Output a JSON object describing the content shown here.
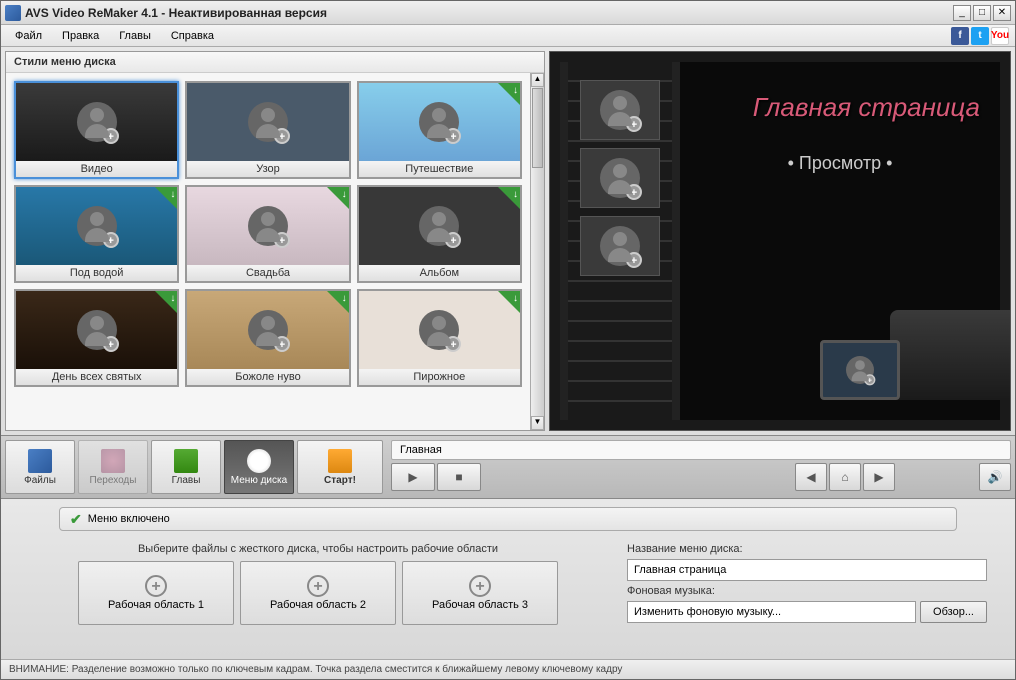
{
  "window": {
    "title": "AVS Video ReMaker 4.1 - Неактивированная версия"
  },
  "menubar": [
    "Файл",
    "Правка",
    "Главы",
    "Справка"
  ],
  "social": {
    "fb": "f",
    "tw": "t",
    "yt": "You"
  },
  "styles_panel": {
    "header": "Стили меню диска",
    "items": [
      {
        "label": "Видео",
        "thumb": "video",
        "selected": true,
        "download": false
      },
      {
        "label": "Узор",
        "thumb": "pattern",
        "selected": false,
        "download": false
      },
      {
        "label": "Путешествие",
        "thumb": "travel",
        "selected": false,
        "download": true
      },
      {
        "label": "Под водой",
        "thumb": "underwater",
        "selected": false,
        "download": true
      },
      {
        "label": "Свадьба",
        "thumb": "wedding",
        "selected": false,
        "download": true
      },
      {
        "label": "Альбом",
        "thumb": "album",
        "selected": false,
        "download": true
      },
      {
        "label": "День всех святых",
        "thumb": "halloween",
        "selected": false,
        "download": true
      },
      {
        "label": "Божоле нуво",
        "thumb": "beaujolais",
        "selected": false,
        "download": true
      },
      {
        "label": "Пирожное",
        "thumb": "cake",
        "selected": false,
        "download": true
      }
    ]
  },
  "preview": {
    "title": "Главная страница",
    "link": "• Просмотр •"
  },
  "toolbar": {
    "files": "Файлы",
    "transitions": "Переходы",
    "chapters": "Главы",
    "disc_menu": "Меню диска",
    "start": "Старт!"
  },
  "breadcrumb": {
    "root": "Главная"
  },
  "menu_enabled": "Меню включено",
  "workspaces": {
    "hint": "Выберите файлы с жесткого диска, чтобы настроить рабочие области",
    "items": [
      "Рабочая область 1",
      "Рабочая область 2",
      "Рабочая область 3"
    ]
  },
  "settings": {
    "title_label": "Название меню диска:",
    "title_value": "Главная страница",
    "music_label": "Фоновая музыка:",
    "music_value": "Изменить фоновую музыку...",
    "browse": "Обзор..."
  },
  "statusbar": "ВНИМАНИЕ: Разделение возможно только по ключевым кадрам. Точка раздела сместится к ближайшему левому ключевому кадру"
}
